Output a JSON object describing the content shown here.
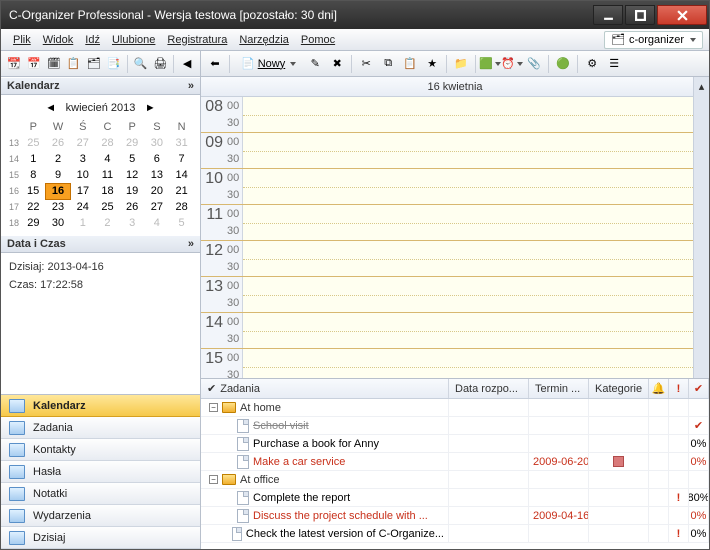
{
  "window": {
    "title": "C-Organizer Professional - Wersja testowa [pozostało: 30 dni]"
  },
  "menu": {
    "items": [
      "Plik",
      "Widok",
      "Idź",
      "Ulubione",
      "Registratura",
      "Narzędzia",
      "Pomoc"
    ],
    "org_label": "c-organizer"
  },
  "left": {
    "calendar_hd": "Kalendarz",
    "month_label": "kwiecień 2013",
    "dow": [
      "P",
      "W",
      "Ś",
      "C",
      "P",
      "S",
      "N"
    ],
    "weeks": [
      {
        "wk": "13",
        "days": [
          {
            "d": 25,
            "dim": true
          },
          {
            "d": 26,
            "dim": true
          },
          {
            "d": 27,
            "dim": true
          },
          {
            "d": 28,
            "dim": true
          },
          {
            "d": 29,
            "dim": true
          },
          {
            "d": 30,
            "dim": true
          },
          {
            "d": 31,
            "dim": true
          }
        ]
      },
      {
        "wk": "14",
        "days": [
          {
            "d": 1
          },
          {
            "d": 2
          },
          {
            "d": 3
          },
          {
            "d": 4
          },
          {
            "d": 5
          },
          {
            "d": 6
          },
          {
            "d": 7
          }
        ]
      },
      {
        "wk": "15",
        "days": [
          {
            "d": 8
          },
          {
            "d": 9
          },
          {
            "d": 10
          },
          {
            "d": 11
          },
          {
            "d": 12
          },
          {
            "d": 13
          },
          {
            "d": 14
          }
        ]
      },
      {
        "wk": "16",
        "days": [
          {
            "d": 15
          },
          {
            "d": 16,
            "today": true
          },
          {
            "d": 17
          },
          {
            "d": 18
          },
          {
            "d": 19
          },
          {
            "d": 20
          },
          {
            "d": 21
          }
        ]
      },
      {
        "wk": "17",
        "days": [
          {
            "d": 22
          },
          {
            "d": 23
          },
          {
            "d": 24
          },
          {
            "d": 25
          },
          {
            "d": 26
          },
          {
            "d": 27
          },
          {
            "d": 28
          }
        ]
      },
      {
        "wk": "18",
        "days": [
          {
            "d": 29
          },
          {
            "d": 30
          },
          {
            "d": 1,
            "dim": true
          },
          {
            "d": 2,
            "dim": true
          },
          {
            "d": 3,
            "dim": true
          },
          {
            "d": 4,
            "dim": true
          },
          {
            "d": 5,
            "dim": true
          }
        ]
      }
    ],
    "dt_hd": "Data i Czas",
    "date_text": "Dzisiaj: 2013-04-16",
    "time_text": "Czas: 17:22:58",
    "nav": [
      {
        "label": "Kalendarz",
        "active": true
      },
      {
        "label": "Zadania"
      },
      {
        "label": "Kontakty"
      },
      {
        "label": "Hasła"
      },
      {
        "label": "Notatki"
      },
      {
        "label": "Wydarzenia"
      },
      {
        "label": "Dzisiaj"
      }
    ]
  },
  "right": {
    "new_label": "Nowy",
    "day_hd": "16 kwietnia",
    "hours": [
      "08",
      "09",
      "10",
      "11",
      "12",
      "13",
      "14",
      "15"
    ],
    "tasks_hd": {
      "subject": "Zadania",
      "start": "Data rozpo...",
      "due": "Termin ...",
      "cat": "Kategorie"
    },
    "groups": [
      {
        "name": "At home",
        "rows": [
          {
            "subject": "School visit",
            "strike": true,
            "done": true
          },
          {
            "subject": "Purchase a book for Anny",
            "pct": "0%"
          },
          {
            "subject": "Make a car service",
            "red": true,
            "due": "2009-06-20",
            "catbox": true,
            "pct": "0%"
          }
        ]
      },
      {
        "name": "At office",
        "rows": [
          {
            "subject": "Complete the report",
            "bang": true,
            "pct": "80%"
          },
          {
            "subject": "Discuss the project schedule with ...",
            "red": true,
            "due": "2009-04-16",
            "pct": "0%"
          },
          {
            "subject": "Check the latest version of C-Organize...",
            "bang": true,
            "pct": "0%"
          }
        ]
      }
    ]
  }
}
